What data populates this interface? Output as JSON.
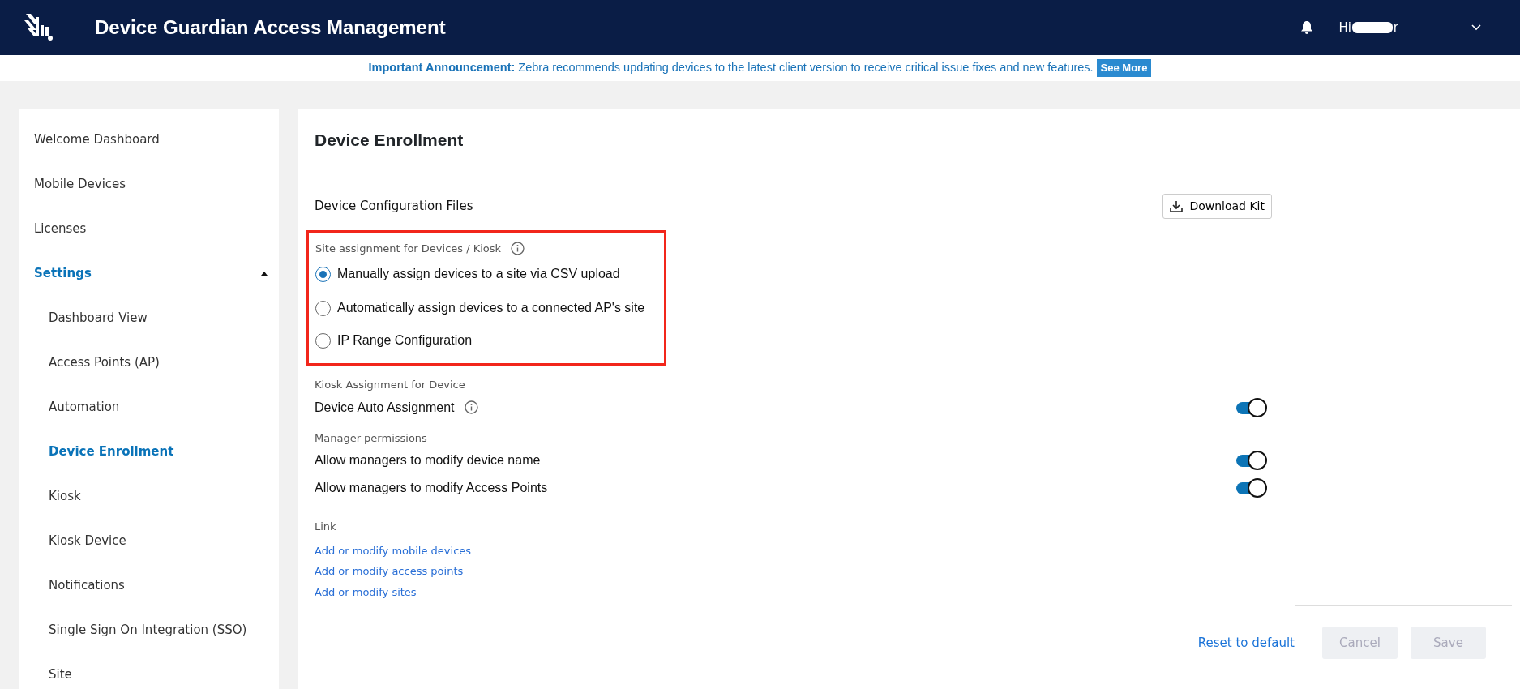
{
  "header": {
    "title": "Device Guardian Access Management",
    "greeting_prefix": "Hi",
    "greeting_suffix": "r"
  },
  "announcement": {
    "label": "Important Announcement:",
    "text": "Zebra recommends updating devices to the latest client version to receive critical issue fixes and new features.",
    "button": "See More"
  },
  "sidebar": {
    "items": [
      {
        "label": "Welcome Dashboard",
        "selected": false
      },
      {
        "label": "Mobile Devices",
        "selected": false
      },
      {
        "label": "Licenses",
        "selected": false
      },
      {
        "label": "Settings",
        "selected": true,
        "expanded": true,
        "children": [
          {
            "label": "Dashboard View",
            "selected": false
          },
          {
            "label": "Access Points (AP)",
            "selected": false
          },
          {
            "label": "Automation",
            "selected": false
          },
          {
            "label": "Device Enrollment",
            "selected": true
          },
          {
            "label": "Kiosk",
            "selected": false
          },
          {
            "label": "Kiosk Device",
            "selected": false
          },
          {
            "label": "Notifications",
            "selected": false
          },
          {
            "label": "Single Sign On Integration (SSO)",
            "selected": false
          },
          {
            "label": "Site",
            "selected": false
          }
        ]
      }
    ]
  },
  "page": {
    "title": "Device Enrollment",
    "config_files_label": "Device Configuration Files",
    "download_button": "Download Kit",
    "site_assignment": {
      "label": "Site assignment for Devices / Kiosk",
      "highlighted": true,
      "options": [
        {
          "label": "Manually assign devices to a site via CSV upload",
          "selected": true
        },
        {
          "label": "Automatically assign devices to a connected AP's site",
          "selected": false
        },
        {
          "label": "IP Range Configuration",
          "selected": false
        }
      ]
    },
    "sections": [
      {
        "label": "Kiosk Assignment for Device",
        "toggles": [
          {
            "label": "Device Auto Assignment",
            "info": true,
            "on": true
          }
        ]
      },
      {
        "label": "Manager permissions",
        "toggles": [
          {
            "label": "Allow managers to modify device name",
            "info": false,
            "on": true
          },
          {
            "label": "Allow managers to modify Access Points",
            "info": false,
            "on": true
          }
        ]
      }
    ],
    "links_label": "Link",
    "links": [
      "Add or modify mobile devices",
      "Add or modify access points",
      "Add or modify sites"
    ],
    "footer": {
      "reset": "Reset to default",
      "cancel": {
        "label": "Cancel",
        "disabled": true
      },
      "save": {
        "label": "Save",
        "disabled": true
      }
    }
  }
}
